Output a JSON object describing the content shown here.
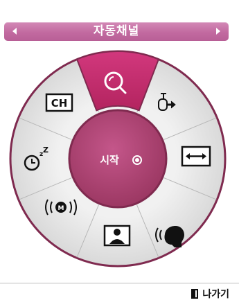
{
  "header": {
    "title": "자동채널",
    "prev_icon": "arrow-left-icon",
    "next_icon": "arrow-right-icon"
  },
  "wheel": {
    "center_label": "시작",
    "center_icon": "radio-dot-icon",
    "selected_item": "search",
    "items": [
      {
        "id": "search",
        "icon": "magnify-search-icon",
        "label": ""
      },
      {
        "id": "input",
        "icon": "input-arrow-icon",
        "label": ""
      },
      {
        "id": "aspect",
        "icon": "double-arrow-icon",
        "label": ""
      },
      {
        "id": "voice",
        "icon": "speaking-head-icon",
        "label": ""
      },
      {
        "id": "picture",
        "icon": "portrait-icon",
        "label": ""
      },
      {
        "id": "mts",
        "icon": "mts-broadcast-icon",
        "label": "(M)"
      },
      {
        "id": "timer",
        "icon": "sleep-timer-icon",
        "label": "Z"
      },
      {
        "id": "channel",
        "icon": "channel-box-icon",
        "label": "CH"
      }
    ]
  },
  "footer": {
    "exit_label": "나가기",
    "exit_icon": "door-exit-icon"
  },
  "colors": {
    "header": "#c26aa0",
    "selected_segment": "#c72d6f",
    "center": "#b04573",
    "ring": "#e6e6e6",
    "ring_outline": "#7a2348"
  }
}
